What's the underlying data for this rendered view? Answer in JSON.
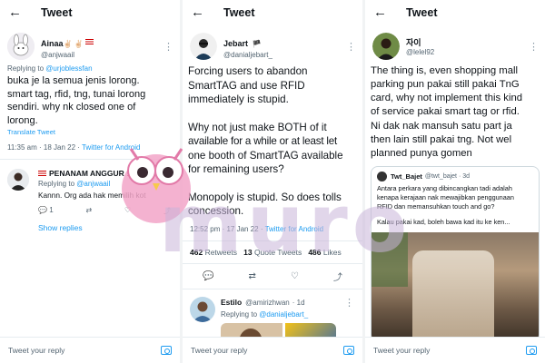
{
  "panel1": {
    "title": "Tweet",
    "author": {
      "name": "Ainaa",
      "badges": "✌🏻 ✌🏻",
      "handle": "@anjwaail"
    },
    "replying_prefix": "Replying to",
    "replying_handle": "@urjoblessfan",
    "lines": [
      "buka je la semua jenis lorong.",
      "smart tag, rfid, tng, tunai lorong",
      "sendiri. why nk closed one of",
      "lorong."
    ],
    "translate": "Translate Tweet",
    "time": "11:35 am · 18 Jan 22 ·",
    "source": "Twitter for Android",
    "reply": {
      "name": "PENANAM ANGGUR",
      "date": "2d",
      "replying_prefix": "Replying to",
      "replying_handle": "@anjwaail",
      "text": "Kannn. Org ada hak memilih kot",
      "reply_count": "1",
      "show_replies": "Show replies"
    },
    "input_placeholder": "Tweet your reply"
  },
  "panel2": {
    "title": "Tweet",
    "author": {
      "name": "Jebart",
      "flag": "🏴",
      "handle": "@danialjebart_"
    },
    "paras": [
      [
        "Forcing users to abandon",
        "SmartTAG and use RFID",
        "immediately is stupid."
      ],
      [
        "Why not just make BOTH of it",
        "available for a while or at least let",
        "one booth of SmartTAG available",
        "for remaining users?"
      ],
      [
        "Monopoly is stupid. So does tolls",
        "concession."
      ]
    ],
    "time": "12:52 pm · 17 Jan 22 ·",
    "source": "Twitter for Android",
    "retweets": "462",
    "retweets_label": "Retweets",
    "quotes": "13",
    "quotes_label": "Quote Tweets",
    "likes": "486",
    "likes_label": "Likes",
    "reply": {
      "name": "Estilo",
      "handle": "@amirizhwan",
      "date": "· 1d",
      "replying_prefix": "Replying to",
      "replying_handle": "@danialjebart_"
    },
    "input_placeholder": "Tweet your reply"
  },
  "panel3": {
    "title": "Tweet",
    "author": {
      "name": "자이",
      "handle": "@lelel92"
    },
    "lines": [
      "The thing is, even shopping mall",
      "parking pun pakai still pakai TnG",
      "card, why not implement this kind",
      "of service pakai smart tag or rfid.",
      "Ni dak nak mansuh satu part ja",
      "then lain still pakai tng. Not wel",
      "planned punya gomen"
    ],
    "quote": {
      "name": "Twt_Bajet",
      "handle": "@twt_bajet · 3d",
      "para1": [
        "Antara perkara yang dibincangkan tadi adalah",
        "kenapa kerajaan nak mewajibkan penggunaan",
        "RFID dan memansuhkan touch and go?"
      ],
      "para2": "Kalau pakai kad, boleh bawa kad itu ke ken..."
    },
    "input_placeholder": "Tweet your reply"
  },
  "watermark": "muro",
  "colors": {
    "link": "#1d9bf0",
    "text": "#0f1419",
    "muted": "#536471",
    "border": "#e6ecf0"
  },
  "icons": [
    "back-arrow-icon",
    "more-dots-icon",
    "reply-icon",
    "retweet-icon",
    "like-icon",
    "share-icon",
    "camera-icon"
  ]
}
